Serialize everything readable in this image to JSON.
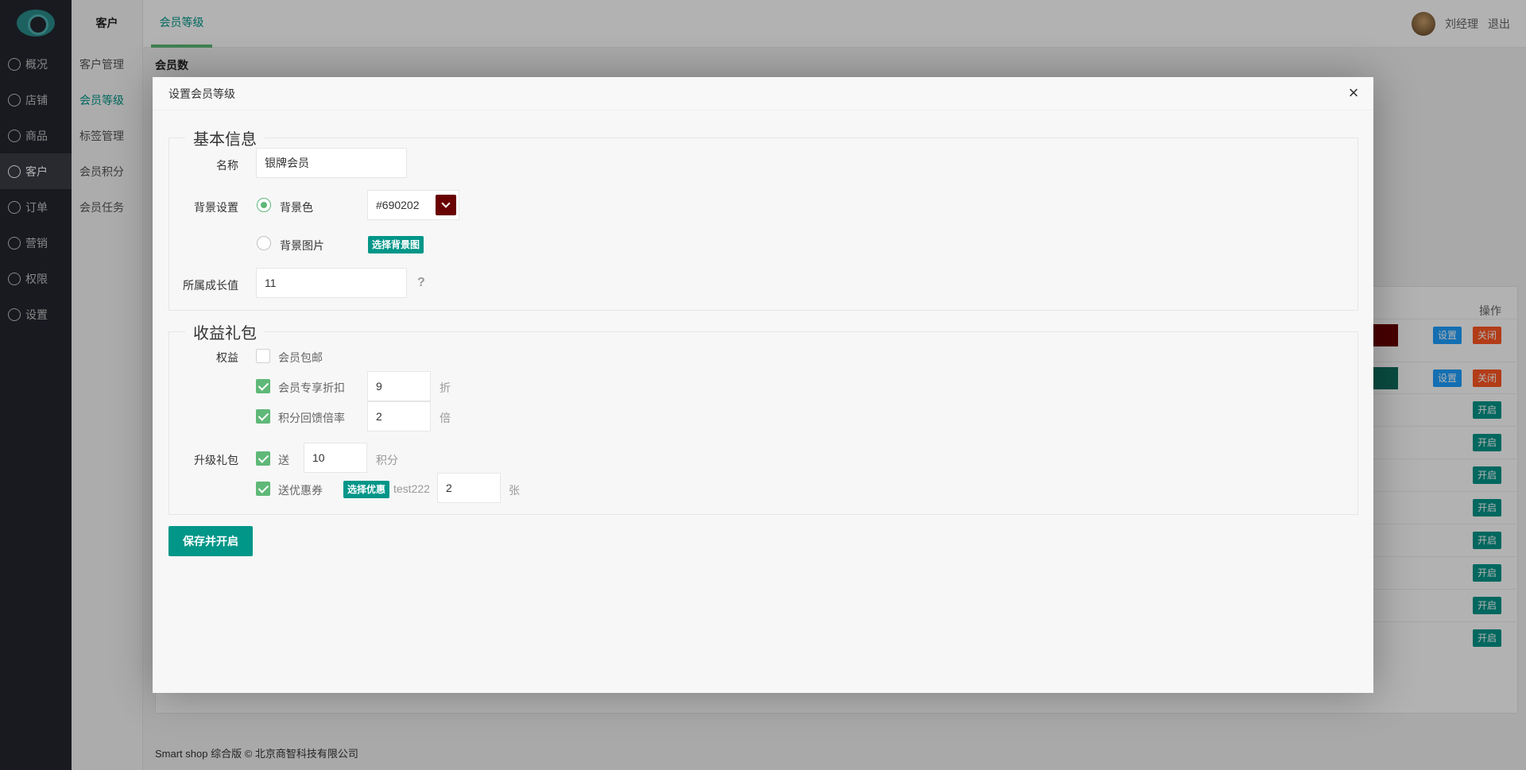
{
  "sidebar": {
    "items": [
      {
        "label": "概况",
        "icon": "dashboard-icon"
      },
      {
        "label": "店铺",
        "icon": "home-icon"
      },
      {
        "label": "商品",
        "icon": "tag-icon"
      },
      {
        "label": "客户",
        "icon": "user-icon",
        "active": true
      },
      {
        "label": "订单",
        "icon": "order-icon"
      },
      {
        "label": "营销",
        "icon": "marketing-icon"
      },
      {
        "label": "权限",
        "icon": "link-icon"
      },
      {
        "label": "设置",
        "icon": "gear-icon"
      }
    ]
  },
  "subnav": {
    "title": "客户",
    "items": [
      "客户管理",
      "会员等级",
      "标签管理",
      "会员积分",
      "会员任务"
    ]
  },
  "topbar": {
    "tab": "会员等级",
    "username": "刘经理",
    "logout": "退出"
  },
  "content": {
    "count_label": "会员数",
    "ops_header": "操作",
    "set_label": "设置",
    "close_label": "关闭",
    "open_label": "开启"
  },
  "footer": "Smart shop 综合版 © 北京商智科技有限公司",
  "modal": {
    "title": "设置会员等级",
    "basic": {
      "legend": "基本信息",
      "name_label": "名称",
      "name_value": "银牌会员",
      "bg_label": "背景设置",
      "bg_color_label": "背景色",
      "bg_color_value": "#690202",
      "bg_image_label": "背景图片",
      "choose_bg_btn": "选择背景图",
      "growth_label": "所属成长值",
      "growth_value": "11",
      "help": "?"
    },
    "gift": {
      "legend": "收益礼包",
      "rights_label": "权益",
      "free_shipping": "会员包邮",
      "discount_label": "会员专享折扣",
      "discount_value": "9",
      "discount_unit": "折",
      "points_rate_label": "积分回馈倍率",
      "points_rate_value": "2",
      "points_rate_unit": "倍",
      "upgrade_label": "升级礼包",
      "send_label": "送",
      "send_points_value": "10",
      "points_unit": "积分",
      "coupon_label": "送优惠券",
      "choose_coupon_btn": "选择优惠",
      "coupon_name": "test222",
      "coupon_count": "2",
      "coupon_unit": "张"
    },
    "save_btn": "保存并开启"
  },
  "colors": {
    "accent": "#009688",
    "green": "#5fb878",
    "swatch": "#690202",
    "row_swatch_2": "#0f6e5e"
  }
}
